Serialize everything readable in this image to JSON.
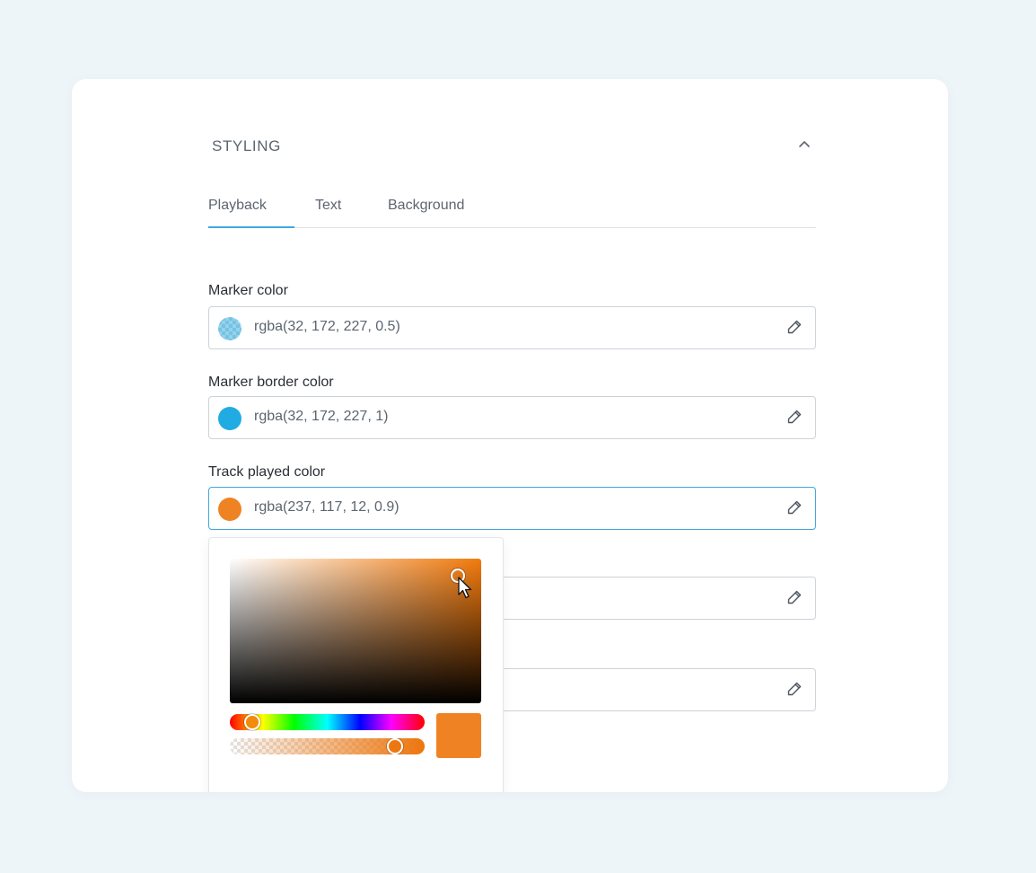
{
  "section": {
    "title": "STYLING",
    "collapse_icon": "chevron-up-icon"
  },
  "tabs": [
    {
      "label": "Playback",
      "active": true
    },
    {
      "label": "Text",
      "active": false
    },
    {
      "label": "Background",
      "active": false
    }
  ],
  "fields": [
    {
      "label": "Marker color",
      "value": "rgba(32, 172, 227, 0.5)",
      "swatch": "rgba(32,172,227,0.5)"
    },
    {
      "label": "Marker border color",
      "value": "rgba(32, 172, 227, 1)",
      "swatch": "rgba(32,172,227,1)"
    },
    {
      "label": "Track played color",
      "value": "rgba(237, 117, 12, 0.9)",
      "swatch": "rgba(237,117,12,0.9)",
      "focused": true
    },
    {
      "label": "",
      "value": "",
      "swatch": ""
    },
    {
      "label": "",
      "value": "",
      "swatch": ""
    }
  ],
  "picker": {
    "hue_color": "#f27a0c",
    "selected_color": "rgba(237,117,12,0.9)",
    "hue_position": 0.08,
    "alpha": 0.9
  },
  "colors": {
    "accent": "#3fa8dc",
    "background": "#eef5f9"
  }
}
